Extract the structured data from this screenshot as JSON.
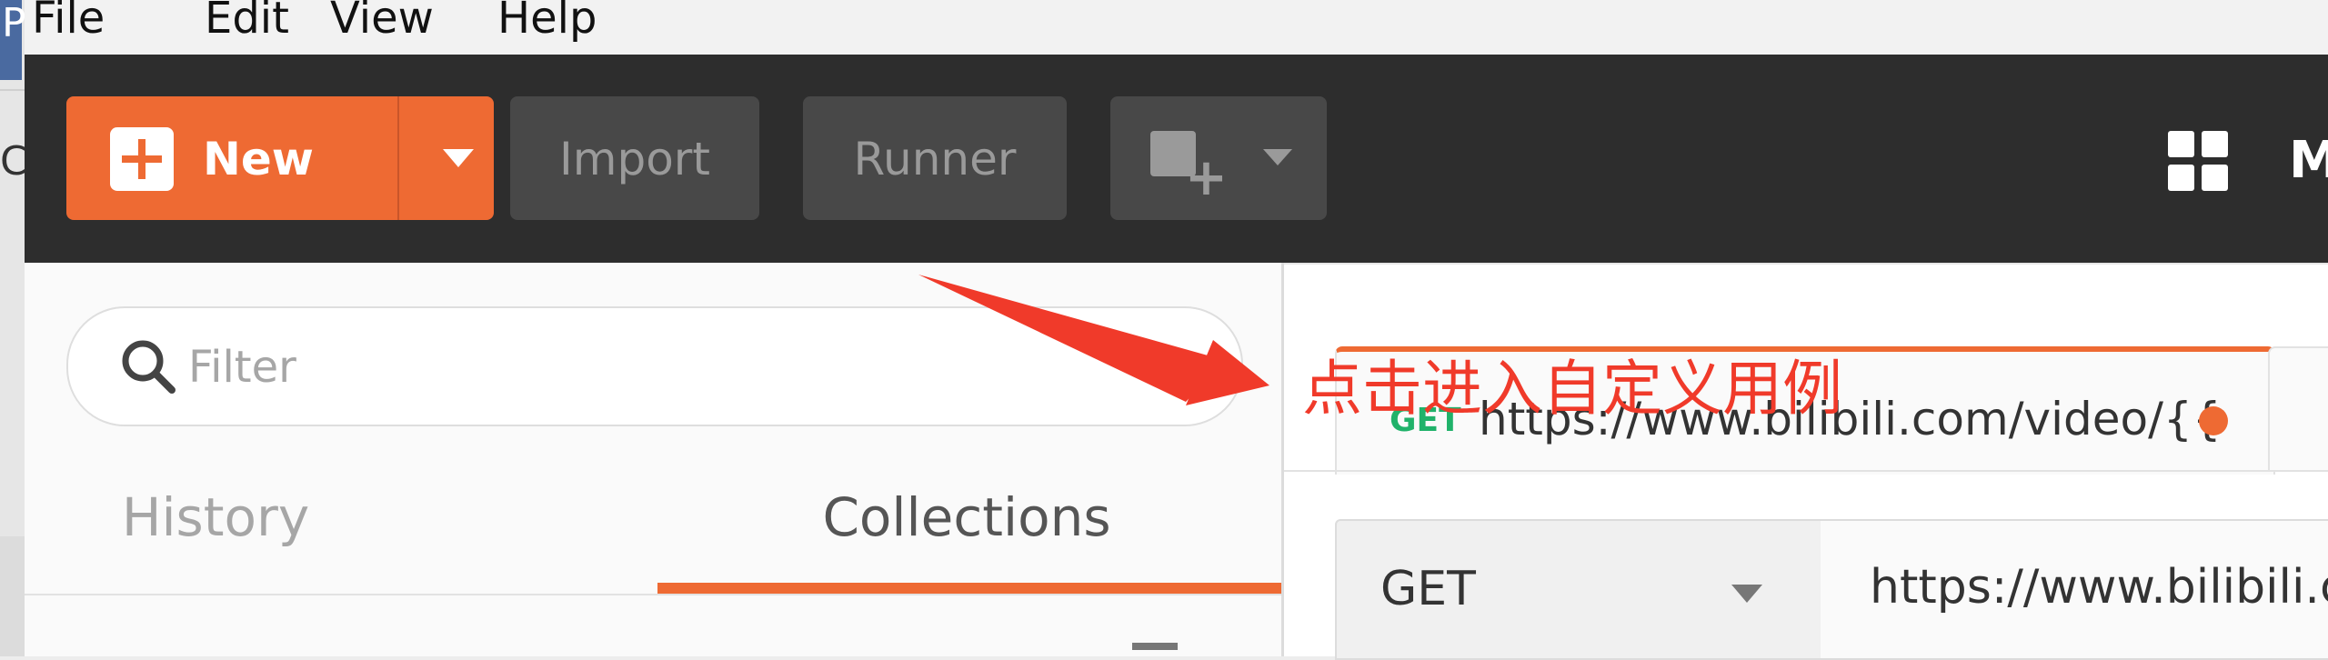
{
  "edge": {
    "top_glyph": "P",
    "mid_glyph": "C"
  },
  "menu": {
    "items": [
      "File",
      "Edit",
      "View",
      "Help"
    ]
  },
  "toolbar": {
    "new_label": "New",
    "import_label": "Import",
    "runner_label": "Runner",
    "workspace_label": "My"
  },
  "sidebar": {
    "filter_placeholder": "Filter",
    "tabs": [
      {
        "label": "History",
        "active": false
      },
      {
        "label": "Collections",
        "active": true
      }
    ]
  },
  "request_tab": {
    "method": "GET",
    "url": "https://www.bilibili.com/video/{{",
    "unsaved": true
  },
  "request": {
    "method": "GET",
    "url": "https://www.bilibili.c"
  },
  "annotation": {
    "text": "点击进入自定义用例",
    "color": "#f03a2a"
  },
  "colors": {
    "accent": "#ee6a33",
    "header_bg": "#2d2d2d",
    "get_method": "#20b26a"
  }
}
